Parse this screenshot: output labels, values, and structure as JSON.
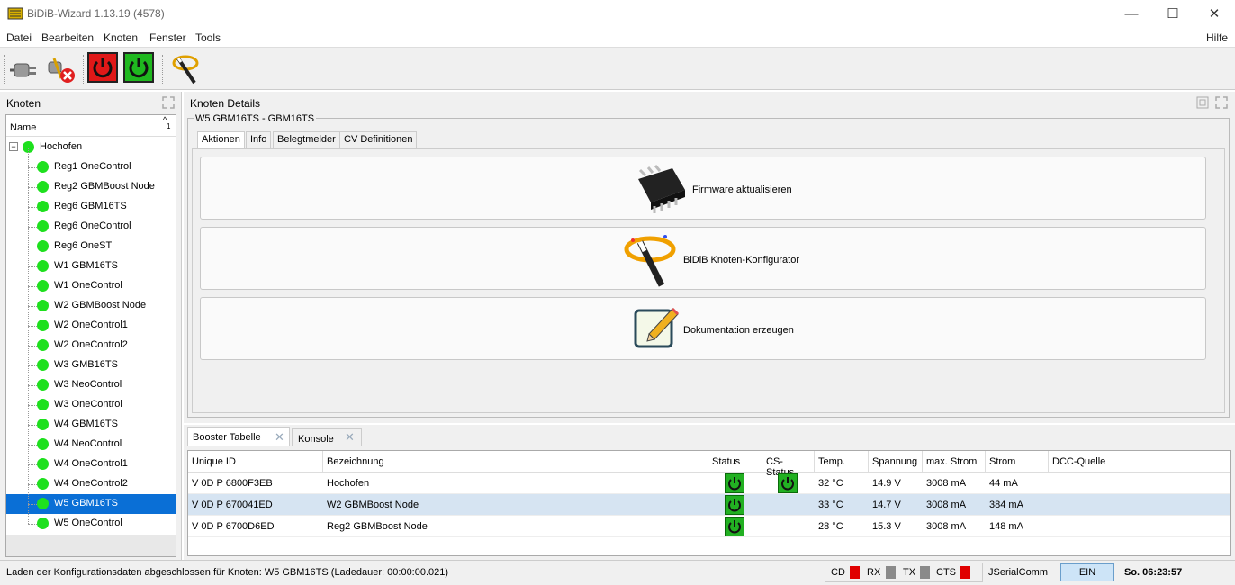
{
  "window": {
    "title": "BiDiB-Wizard 1.13.19 (4578)",
    "minimize_glyph": "—",
    "maximize_glyph": "☐",
    "close_glyph": "✕"
  },
  "menu": {
    "datei": "Datei",
    "bearbeiten": "Bearbeiten",
    "knoten": "Knoten",
    "fenster": "Fenster",
    "tools": "Tools",
    "hilfe": "Hilfe"
  },
  "toolbar": {
    "connect_icon": "plug-connect-icon",
    "disconnect_icon": "plug-disconnect-icon",
    "stop_icon": "power-off-red-icon",
    "go_icon": "power-on-green-icon",
    "wizard_icon": "magic-wand-icon"
  },
  "left_panel": {
    "title": "Knoten",
    "column": "Name",
    "sort_indicator": "1",
    "root": "Hochofen",
    "nodes": [
      "Reg1 OneControl",
      "Reg2 GBMBoost Node",
      "Reg6 GBM16TS",
      "Reg6 OneControl",
      "Reg6 OneST",
      "W1 GBM16TS",
      "W1 OneControl",
      "W2 GBMBoost Node",
      "W2 OneControl1",
      "W2 OneControl2",
      "W3 GMB16TS",
      "W3 NeoControl",
      "W3 OneControl",
      "W4 GBM16TS",
      "W4 NeoControl",
      "W4 OneControl1",
      "W4 OneControl2",
      "W5 GBM16TS",
      "W5 OneControl"
    ],
    "selected": "W5 GBM16TS"
  },
  "details": {
    "title": "Knoten Details",
    "node_label": "W5 GBM16TS - GBM16TS",
    "tabs": [
      "Aktionen",
      "Info",
      "Belegtmelder",
      "CV Definitionen"
    ],
    "active_tab": "Aktionen",
    "actions": {
      "firmware": "Firmware aktualisieren",
      "konfigurator": "BiDiB Knoten-Konfigurator",
      "doku": "Dokumentation erzeugen"
    }
  },
  "bottom_tabs": {
    "booster": "Booster Tabelle",
    "konsole": "Konsole"
  },
  "booster_table": {
    "headers": [
      "Unique ID",
      "Bezeichnung",
      "Status",
      "CS-Status",
      "Temp.",
      "Spannung",
      "max. Strom",
      "Strom",
      "DCC-Quelle"
    ],
    "rows": [
      {
        "uid": "V 0D P 6800F3EB",
        "name": "Hochofen",
        "temp": "32 °C",
        "volt": "14.9 V",
        "max": "3008 mA",
        "strom": "44 mA"
      },
      {
        "uid": "V 0D P 670041ED",
        "name": "W2 GBMBoost Node",
        "temp": "33 °C",
        "volt": "14.7 V",
        "max": "3008 mA",
        "strom": "384 mA"
      },
      {
        "uid": "V 0D P 6700D6ED",
        "name": "Reg2 GBMBoost Node",
        "temp": "28 °C",
        "volt": "15.3 V",
        "max": "3008 mA",
        "strom": "148 mA"
      }
    ]
  },
  "status": {
    "message": "Laden der Konfigurationsdaten abgeschlossen für Knoten: W5 GBM16TS (Ladedauer: 00:00:00.021)",
    "cd": "CD",
    "rx": "RX",
    "tx": "TX",
    "cts": "CTS",
    "lib": "JSerialComm",
    "power": "EIN",
    "clock": "So. 06:23:57"
  },
  "colors": {
    "led_red": "#e00000",
    "led_grey": "#8a8a8a",
    "selected": "#0a6fd6",
    "node_ok": "#1ee01e"
  }
}
